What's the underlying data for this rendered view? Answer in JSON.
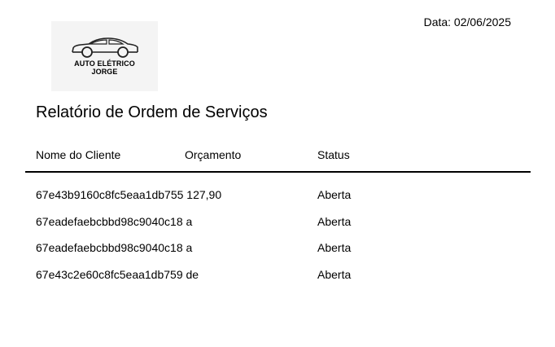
{
  "header": {
    "date_text": "Data: 02/06/2025"
  },
  "logo": {
    "icon": "car-icon",
    "line1": "AUTO ELÉTRICO",
    "line2": "JORGE"
  },
  "title": "Relatório de Ordem de Serviços",
  "table": {
    "columns": [
      "Nome do Cliente",
      "Orçamento",
      "Status"
    ],
    "rows": [
      {
        "cliente": "67e43b9160c8fc5eaa1db755 127,90",
        "status": "Aberta"
      },
      {
        "cliente": "67eadefaebcbbd98c9040c18 a",
        "status": "Aberta"
      },
      {
        "cliente": "67eadefaebcbbd98c9040c18 a",
        "status": "Aberta"
      },
      {
        "cliente": "67e43c2e60c8fc5eaa1db759 de",
        "status": "Aberta"
      }
    ]
  }
}
